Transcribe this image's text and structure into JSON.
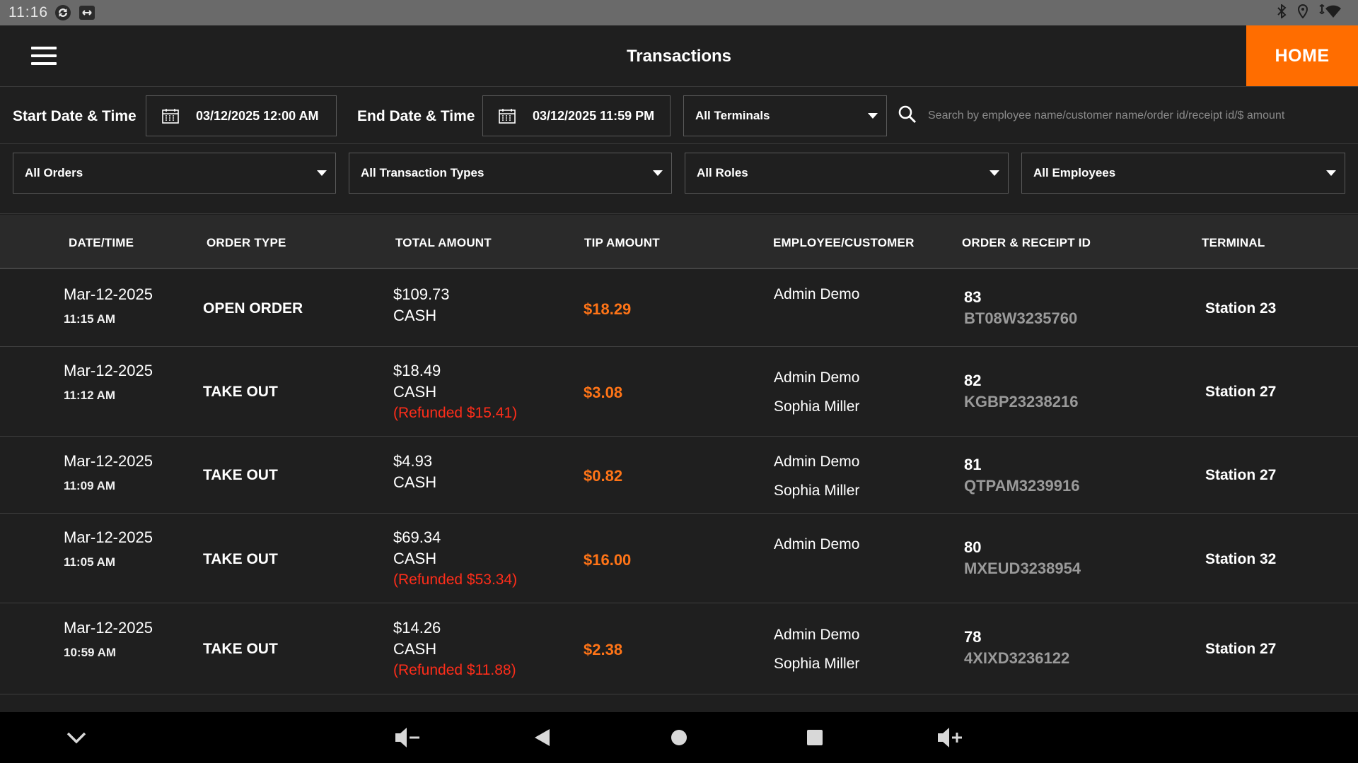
{
  "status_bar": {
    "time": "11:16",
    "icons": [
      "sync-icon",
      "remote-icon",
      "bluetooth-icon",
      "location-icon",
      "wifi-icon"
    ]
  },
  "header": {
    "title": "Transactions",
    "home_label": "HOME"
  },
  "filters": {
    "start_label": "Start Date & Time",
    "start_value": "03/12/2025 12:00 AM",
    "end_label": "End Date & Time",
    "end_value": "03/12/2025 11:59 PM",
    "terminals": "All Terminals",
    "search_placeholder": "Search by employee name/customer name/order id/receipt id/$ amount",
    "orders": "All Orders",
    "transaction_types": "All Transaction Types",
    "roles": "All Roles",
    "employees": "All Employees"
  },
  "table": {
    "columns": [
      "DATE/TIME",
      "ORDER TYPE",
      "TOTAL AMOUNT",
      "TIP AMOUNT",
      "EMPLOYEE/CUSTOMER",
      "ORDER & RECEIPT ID",
      "TERMINAL"
    ],
    "rows": [
      {
        "date": "Mar-12-2025",
        "time": "11:15 AM",
        "order_type": "OPEN ORDER",
        "amount": "$109.73",
        "method": "CASH",
        "refund": "",
        "tip": "$18.29",
        "employee": "Admin Demo",
        "customer": "",
        "order_id": "83",
        "receipt_id": "BT08W3235760",
        "terminal": "Station 23"
      },
      {
        "date": "Mar-12-2025",
        "time": "11:12 AM",
        "order_type": "TAKE OUT",
        "amount": "$18.49",
        "method": "CASH",
        "refund": "(Refunded $15.41)",
        "tip": "$3.08",
        "employee": "Admin Demo",
        "customer": "Sophia Miller",
        "order_id": "82",
        "receipt_id": "KGBP23238216",
        "terminal": "Station 27"
      },
      {
        "date": "Mar-12-2025",
        "time": "11:09 AM",
        "order_type": "TAKE OUT",
        "amount": "$4.93",
        "method": "CASH",
        "refund": "",
        "tip": "$0.82",
        "employee": "Admin Demo",
        "customer": "Sophia Miller",
        "order_id": "81",
        "receipt_id": "QTPAM3239916",
        "terminal": "Station 27"
      },
      {
        "date": "Mar-12-2025",
        "time": "11:05 AM",
        "order_type": "TAKE OUT",
        "amount": "$69.34",
        "method": "CASH",
        "refund": "(Refunded $53.34)",
        "tip": "$16.00",
        "employee": "Admin Demo",
        "customer": "",
        "order_id": "80",
        "receipt_id": "MXEUD3238954",
        "terminal": "Station 32"
      },
      {
        "date": "Mar-12-2025",
        "time": "10:59 AM",
        "order_type": "TAKE OUT",
        "amount": "$14.26",
        "method": "CASH",
        "refund": "(Refunded $11.88)",
        "tip": "$2.38",
        "employee": "Admin Demo",
        "customer": "Sophia Miller",
        "order_id": "78",
        "receipt_id": "4XIXD3236122",
        "terminal": "Station 27"
      }
    ]
  },
  "nav_bar": {
    "icons": [
      "collapse-icon",
      "volume-down-icon",
      "back-icon",
      "home-icon",
      "recents-icon",
      "volume-up-icon"
    ]
  },
  "colors": {
    "accent": "#ff6d00",
    "tip": "#ff7417",
    "refund": "#ff2d1a",
    "background": "#1f1f1f"
  }
}
